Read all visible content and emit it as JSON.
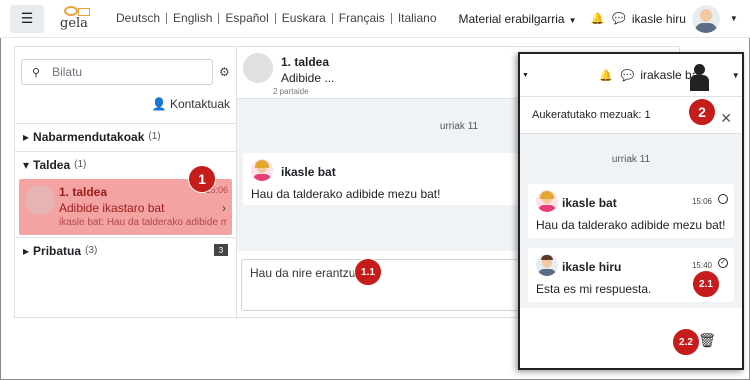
{
  "navbar": {
    "languages": [
      "Deutsch",
      "English",
      "Español",
      "Euskara",
      "Français",
      "Italiano"
    ],
    "menu_label": "Material erabilgarria",
    "user_name": "ikasle hiru"
  },
  "left": {
    "search_placeholder": "Bilatu",
    "contacts_label": "Kontaktuak",
    "sections": [
      {
        "label": "Nabarmendutakoak",
        "count": "(1)"
      },
      {
        "label": "Taldea",
        "count": "(1)"
      },
      {
        "label": "Pribatua",
        "count": "(3)",
        "badge": "3"
      }
    ],
    "conversation": {
      "title": "1. taldea",
      "subtitle": "Adibide ikastaro bat",
      "preview_sender": "ikasle bat:",
      "preview_text": "Hau da talderako adibide mezu bat!",
      "time": "15:06"
    }
  },
  "center": {
    "title": "1. taldea",
    "subtitle": "Adibide ...",
    "participants": "2 partaide",
    "date": "urriak 11",
    "message": {
      "sender": "ikasle bat",
      "text": "Hau da talderako adibide mezu bat!"
    },
    "reply_text": "Hau da nire erantzuna"
  },
  "overlay": {
    "user_name": "irakasle bat",
    "selected_label": "Aukeratutako mezuak: 1",
    "date": "urriak 11",
    "messages": [
      {
        "sender": "ikasle bat",
        "time": "15:06",
        "text": "Hau da talderako adibide mezu bat!"
      },
      {
        "sender": "ikasle hiru",
        "time": "15:40",
        "text": "Esta es mi respuesta."
      }
    ]
  },
  "markers": [
    "1",
    "1.1",
    "2",
    "2.1",
    "2.2"
  ],
  "colors": {
    "marker": "#c71c1c",
    "selected_conversation": "#f4a3a3",
    "chat_background": "#eff3f6"
  }
}
